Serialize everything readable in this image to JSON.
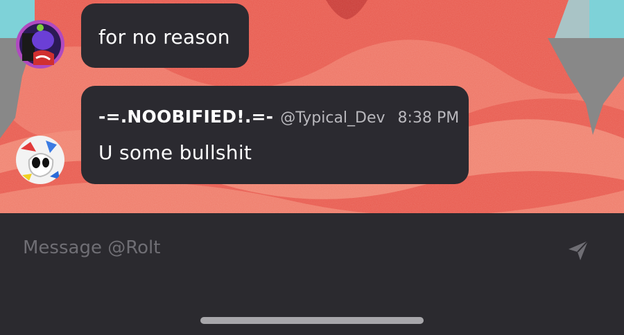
{
  "messages": [
    {
      "avatar": "purple-character-avatar",
      "text": "for no reason"
    },
    {
      "avatar": "white-creature-avatar",
      "author": "-=.NOOBIFIED!.=-",
      "handle": "@Typical_Dev",
      "time": "8:38 PM",
      "text": "U some bullshit"
    }
  ],
  "composer": {
    "placeholder": "Message @Rolt",
    "send_icon": "send-icon"
  },
  "colors": {
    "background_red": "#e85a4e",
    "bubble": "#2b2a30",
    "composer": "#2b2a2f",
    "placeholder": "#6f6e74",
    "meta": "#b9b8bd"
  }
}
